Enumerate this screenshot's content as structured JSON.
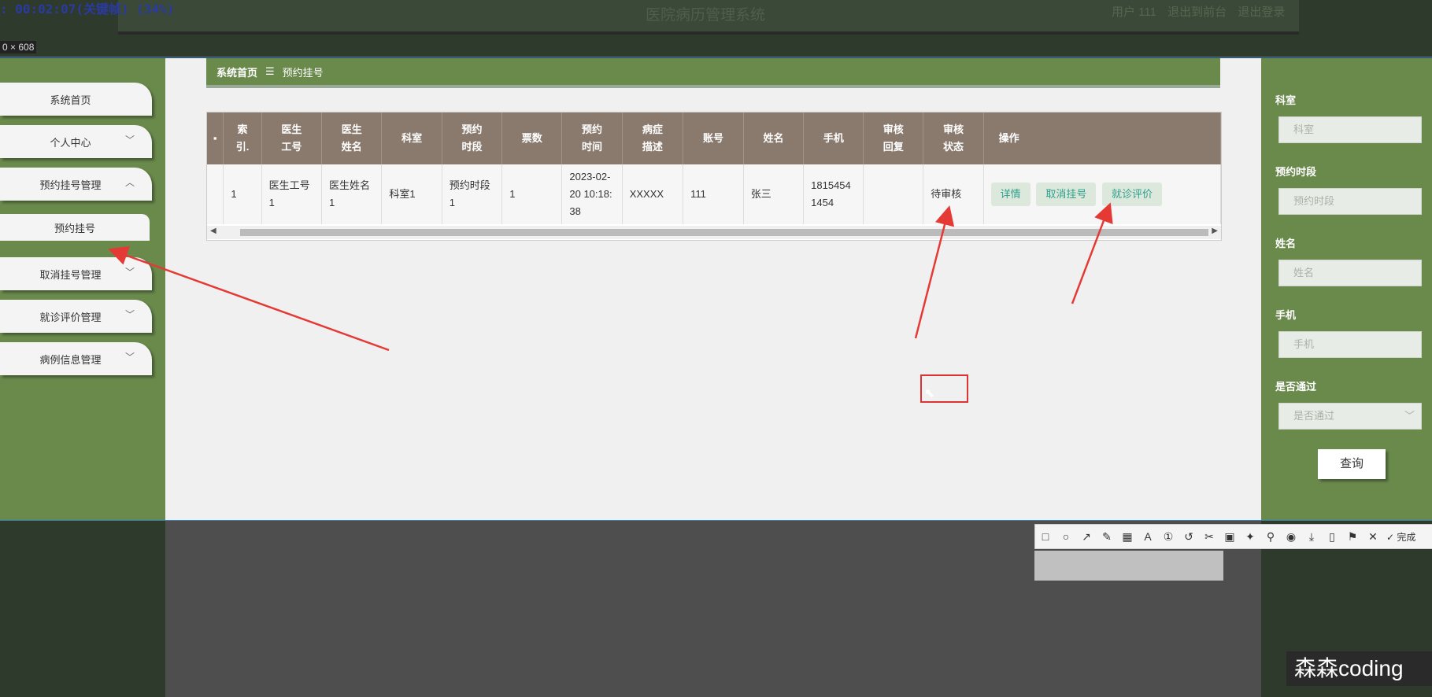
{
  "recording": {
    "status": ": 00:02:07(关键帧) (34%)",
    "dimension_label": "0 × 608"
  },
  "header": {
    "title": "医院病历管理系统",
    "user": "用户 111",
    "back_to_front": "退出到前台",
    "logout": "退出登录"
  },
  "sidebar": {
    "items": [
      {
        "label": "系统首页",
        "has_chevron": false,
        "expanded": false
      },
      {
        "label": "个人中心",
        "has_chevron": true,
        "expanded": false
      },
      {
        "label": "预约挂号管理",
        "has_chevron": true,
        "expanded": true
      },
      {
        "label": "预约挂号",
        "sub": true
      },
      {
        "label": "取消挂号管理",
        "has_chevron": true,
        "expanded": false
      },
      {
        "label": "就诊评价管理",
        "has_chevron": true,
        "expanded": false
      },
      {
        "label": "病例信息管理",
        "has_chevron": true,
        "expanded": false
      }
    ],
    "chevron_down": "﹀",
    "chevron_up": "︿"
  },
  "breadcrumb": {
    "home": "系统首页",
    "separator": "☰",
    "current": "预约挂号"
  },
  "table": {
    "columns": [
      "",
      "索\n引.",
      "医生\n工号",
      "医生\n姓名",
      "科室",
      "预约\n时段",
      "票数",
      "预约\n时间",
      "病症\n描述",
      "账号",
      "姓名",
      "手机",
      "审核\n回复",
      "审核\n状态",
      "操作"
    ],
    "rows": [
      {
        "index": "1",
        "doctor_id": "医生工号1",
        "doctor_name": "医生姓名1",
        "department": "科室1",
        "slot": "预约时段1",
        "tickets": "1",
        "time": "2023-02-20 10:18:38",
        "symptom": "XXXXX",
        "account": "111",
        "name": "张三",
        "phone": "18154541454",
        "reply": "",
        "status": "待审核",
        "actions": [
          "详情",
          "取消挂号",
          "就诊评价"
        ]
      }
    ]
  },
  "search_panel": {
    "fields": [
      {
        "label": "科室",
        "placeholder": "科室"
      },
      {
        "label": "预约时段",
        "placeholder": "预约时段"
      },
      {
        "label": "姓名",
        "placeholder": "姓名"
      },
      {
        "label": "手机",
        "placeholder": "手机"
      },
      {
        "label": "是否通过",
        "placeholder": "是否通过",
        "dropdown": "﹀"
      }
    ],
    "query_button": "查询"
  },
  "screenshot_toolbar": {
    "done_label": "完成"
  },
  "watermark": "森森coding",
  "colors": {
    "sidebar_green": "#6a8a4c",
    "table_header": "#8a7a6e",
    "action_text": "#2f9f8c",
    "annotation_red": "#e53935"
  }
}
